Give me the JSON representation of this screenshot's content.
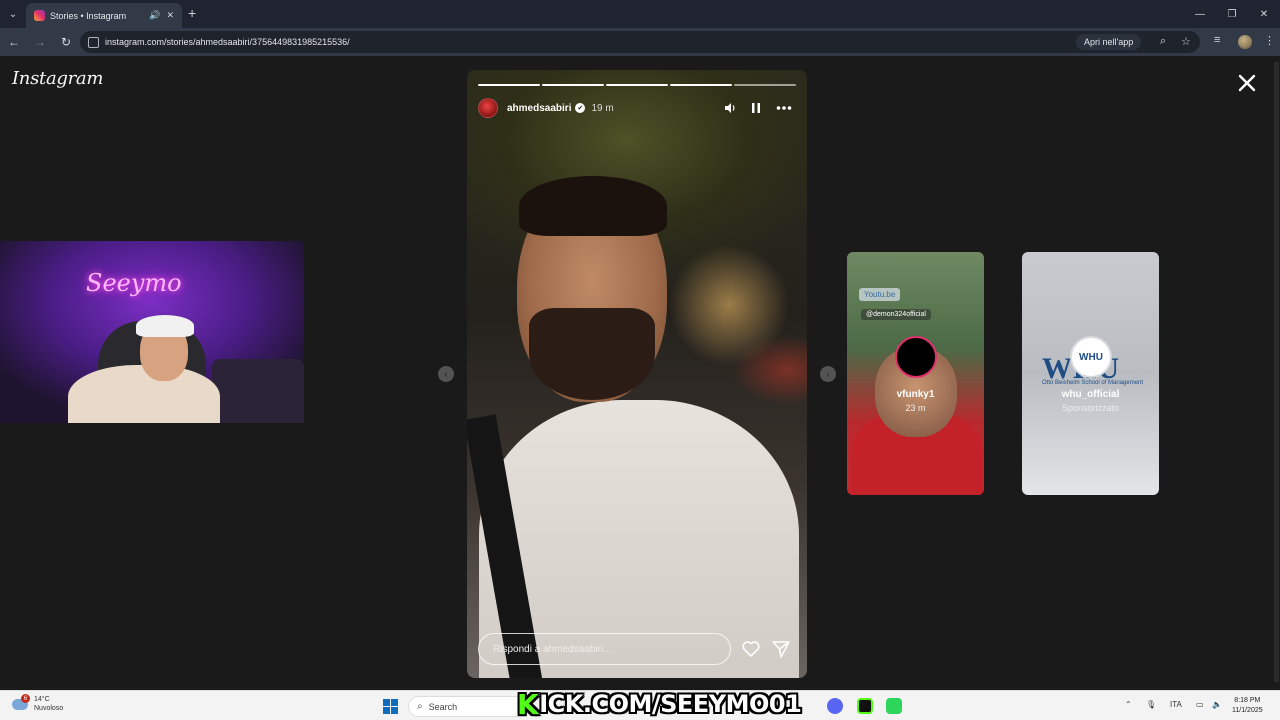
{
  "browser": {
    "tab_title": "Stories • Instagram",
    "url": "instagram.com/stories/ahmedsaabiri/3756449831985215536/",
    "open_in_app": "Apri nell'app"
  },
  "page": {
    "logo": "Instagram"
  },
  "story": {
    "username": "ahmedsaabiri",
    "time": "19 m",
    "reply_placeholder": "Rispondi a ahmedsaabiri...",
    "segments_total": 5,
    "segments_done": 4
  },
  "previews": [
    {
      "name": "vfunky1",
      "subtitle": "23 m",
      "link_chip": "Youtu.be",
      "mention_chip": "@demon324official"
    },
    {
      "name": "whu_official",
      "subtitle": "Sponsorizzato",
      "logo_text": "WHU",
      "logo_sub": "Otto Beisheim School of Management"
    }
  ],
  "webcam": {
    "neon_sign": "Seeymo"
  },
  "overlay": {
    "kick_text": "KICK.COM/SEEYMO01"
  },
  "taskbar": {
    "weather_temp": "14°C",
    "weather_desc": "Nuvoloso",
    "weather_badge": "6",
    "search_label": "Search",
    "language": "ITA",
    "time": "8:18 PM",
    "date": "11/1/2025"
  },
  "colors": {
    "page_bg": "#1a1a1a",
    "chrome_bg": "#323a48",
    "kick_green": "#53fc18"
  }
}
